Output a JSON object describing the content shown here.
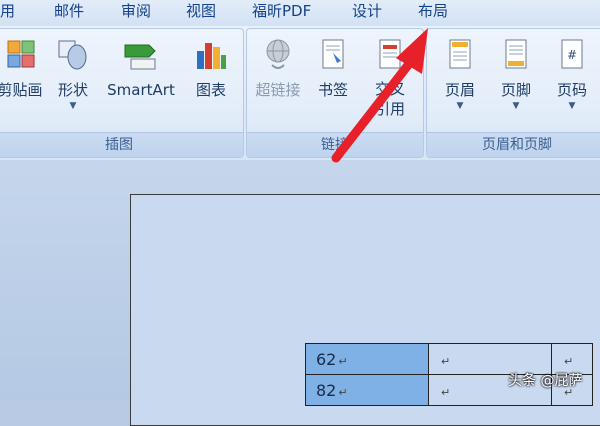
{
  "tabs": [
    "用",
    "邮件",
    "审阅",
    "视图",
    "福昕PDF",
    "设计",
    "布局"
  ],
  "ribbon": {
    "groups": [
      {
        "label": "插图",
        "buttons": [
          {
            "label": "剪贴画",
            "icon": "clipart-icon"
          },
          {
            "label": "形状",
            "icon": "shapes-icon",
            "has_dropdown": true
          },
          {
            "label": "SmartArt",
            "icon": "smartart-icon"
          },
          {
            "label": "图表",
            "icon": "chart-icon"
          }
        ]
      },
      {
        "label": "链接",
        "buttons": [
          {
            "label": "超链接",
            "icon": "hyperlink-icon",
            "disabled": true
          },
          {
            "label": "书签",
            "icon": "bookmark-icon"
          },
          {
            "label1": "交叉",
            "label2": "引用",
            "icon": "cross-reference-icon"
          }
        ]
      },
      {
        "label": "页眉和页脚",
        "buttons": [
          {
            "label": "页眉",
            "icon": "header-icon",
            "has_dropdown": true
          },
          {
            "label": "页脚",
            "icon": "footer-icon",
            "has_dropdown": true
          },
          {
            "label": "页码",
            "icon": "page-number-icon",
            "has_dropdown": true
          }
        ]
      }
    ]
  },
  "document": {
    "table_rows": [
      {
        "col1": "62",
        "col2": "",
        "col3": ""
      },
      {
        "col1": "82",
        "col2": "",
        "col3": ""
      }
    ],
    "paragraph_mark": "↵"
  },
  "watermark": "头条 @屁萨",
  "colors": {
    "annotation_arrow": "#e8202a",
    "cell_highlight": "#7fb0e6",
    "tab_text": "#15428b"
  }
}
